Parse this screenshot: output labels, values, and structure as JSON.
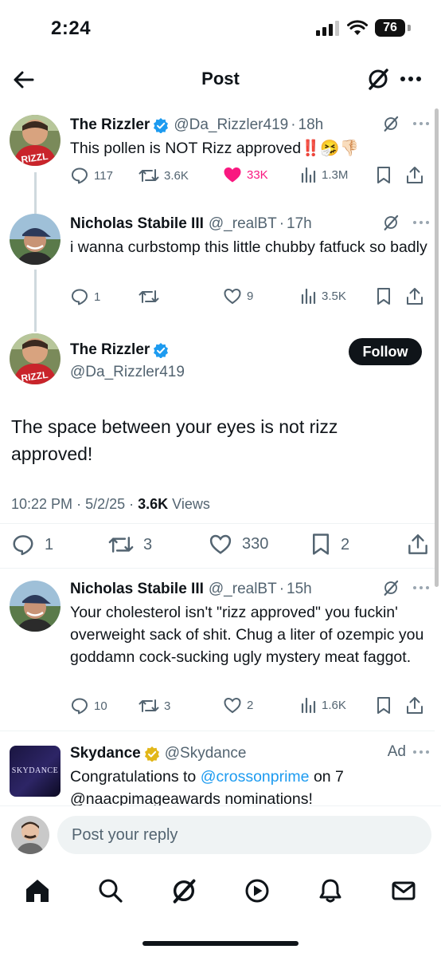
{
  "status": {
    "time": "2:24",
    "battery": "76"
  },
  "header": {
    "title": "Post"
  },
  "posts": [
    {
      "name": "The Rizzler",
      "handle": "@Da_Rizzler419",
      "time": "18h",
      "verified": "blue",
      "text": "This pollen is NOT Rizz approved‼️🤧👎🏻",
      "replies": "117",
      "reposts": "3.6K",
      "likes": "33K",
      "views": "1.3M",
      "liked": true
    },
    {
      "name": "Nicholas Stabile III",
      "handle": "@_realBT",
      "time": "17h",
      "text": "i wanna curbstomp this little chubby fatfuck so badly",
      "replies": "1",
      "reposts": "",
      "likes": "9",
      "views": "3.5K"
    },
    {
      "name": "Nicholas Stabile III",
      "handle": "@_realBT",
      "time": "15h",
      "text": "Your cholesterol isn't \"rizz approved\" you fuckin' overweight sack of shit. Chug a liter of ozempic you goddamn cock-sucking ugly mystery meat faggot.",
      "replies": "10",
      "reposts": "3",
      "likes": "2",
      "views": "1.6K"
    }
  ],
  "focus": {
    "name": "The Rizzler",
    "handle": "@Da_Rizzler419",
    "follow_label": "Follow",
    "text": "The space between your eyes is not rizz approved!",
    "time": "10:22 PM",
    "date": "5/2/25",
    "views_count": "3.6K",
    "views_label": "Views",
    "replies": "1",
    "reposts": "3",
    "likes": "330",
    "bookmarks": "2"
  },
  "ad": {
    "name": "Skydance",
    "handle": "@Skydance",
    "label": "Ad",
    "avatar_text": "SKYDANCE",
    "text_before": "Congratulations to ",
    "mention": "@crossonprime",
    "text_after": " on 7 @naacpimageawards nominations!"
  },
  "reply_bar": {
    "placeholder": "Post your reply"
  },
  "colors": {
    "like_pink": "#f91880",
    "verified_blue": "#1d9bf0",
    "verified_gold": "#e2b719",
    "text_gray": "#536471"
  }
}
